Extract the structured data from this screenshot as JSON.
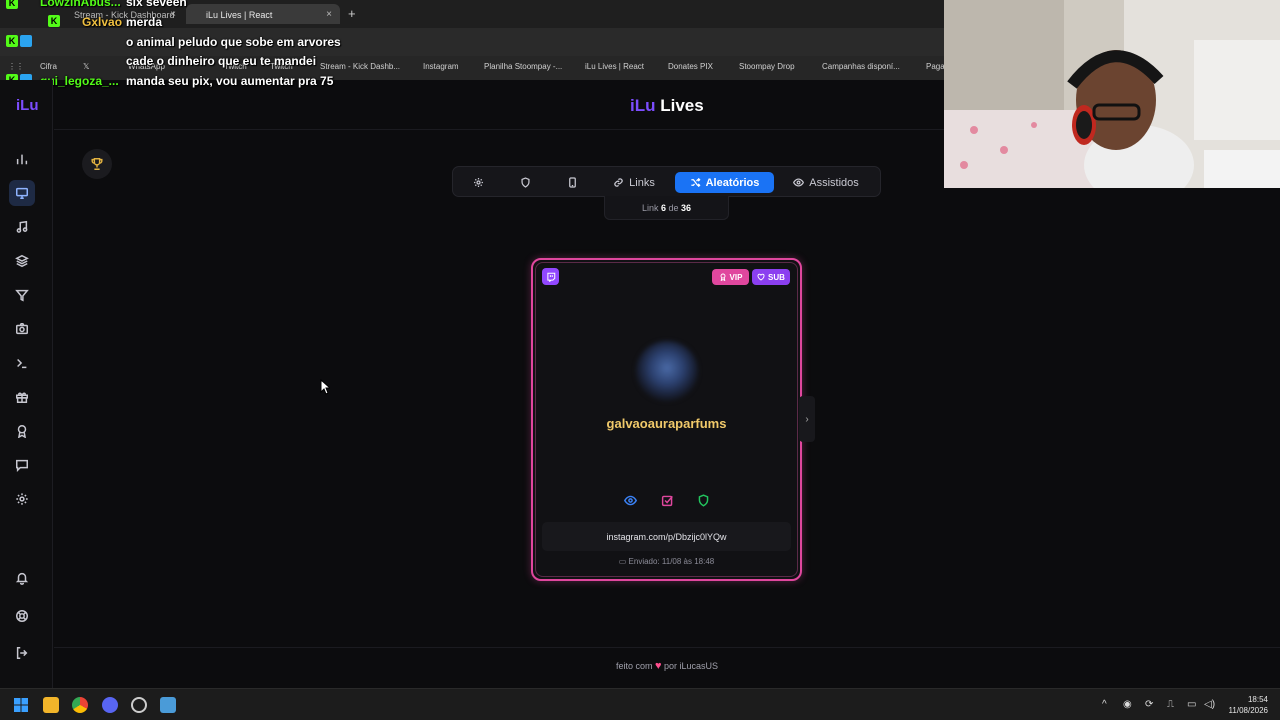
{
  "browser": {
    "tabs": [
      {
        "label": "Stream - Kick Dashboard",
        "active": false
      },
      {
        "label": "iLu Lives | React",
        "active": true
      }
    ],
    "new_tab": "+",
    "close": "×",
    "address": "",
    "bookmarks": [
      "Cifra",
      "WhatsApp",
      "Twitch",
      "Twitch",
      "Stream - Kick Dashb...",
      "Instagram",
      "Planilha Stoompay -...",
      "iLu Lives | React",
      "Donates PIX",
      "Stoompay Drop",
      "Campanhas disponí...",
      "Paga"
    ]
  },
  "chat": [
    {
      "user": "LowzinAbus...",
      "user_color": "#53fc18",
      "message": "six seveen"
    },
    {
      "user": "Gxlvao",
      "user_color": "#f0c040",
      "message": "merda"
    },
    {
      "user": "",
      "user_color": "#ff4444",
      "message": "o animal peludo que sobe em arvores"
    },
    {
      "user": "",
      "user_color": "#ff4444",
      "message": "cade o dinheiro que eu te mandei"
    },
    {
      "user": "gui_legoza_...",
      "user_color": "#53fc18",
      "message": "manda seu pix, vou aumentar pra 75"
    }
  ],
  "app": {
    "logo": "iLu",
    "title_accent": "iLu",
    "title_rest": " Lives",
    "tabs": [
      {
        "label": "",
        "icon": "gear-icon"
      },
      {
        "label": "",
        "icon": "shield-icon"
      },
      {
        "label": "",
        "icon": "phone-icon"
      },
      {
        "label": "Links",
        "icon": "link-icon"
      },
      {
        "label": "Aleatórios",
        "icon": "shuffle-icon",
        "active": true
      },
      {
        "label": "Assistidos",
        "icon": "eye-icon"
      }
    ],
    "counter": {
      "prefix": "Link",
      "current": "6",
      "sep": "de",
      "total": "36"
    },
    "sidebar_icons": [
      "chart-icon",
      "monitor-icon",
      "music-icon",
      "layers-icon",
      "filter-icon",
      "camera-icon",
      "terminal-icon",
      "gift-icon",
      "award-icon",
      "message-icon",
      "settings-icon",
      "bell-icon",
      "help-icon",
      "logout-icon"
    ]
  },
  "card": {
    "platform_icon": "twitch-icon",
    "vip_label": "VIP",
    "sub_label": "SUB",
    "username": "galvaoauraparfums",
    "link": "instagram.com/p/Dbzijc0lYQw",
    "sent": "Enviado: 11/08 às 18:48",
    "colors": {
      "border": "#e0479e",
      "vip": "#e0479e",
      "sub": "#8b3ff0",
      "username": "#f0c96a"
    }
  },
  "footer": {
    "prefix": "feito com",
    "heart": "♥",
    "suffix": "por iLucasUS"
  },
  "taskbar": {
    "time": "18:54",
    "date": "11/08/2026"
  }
}
